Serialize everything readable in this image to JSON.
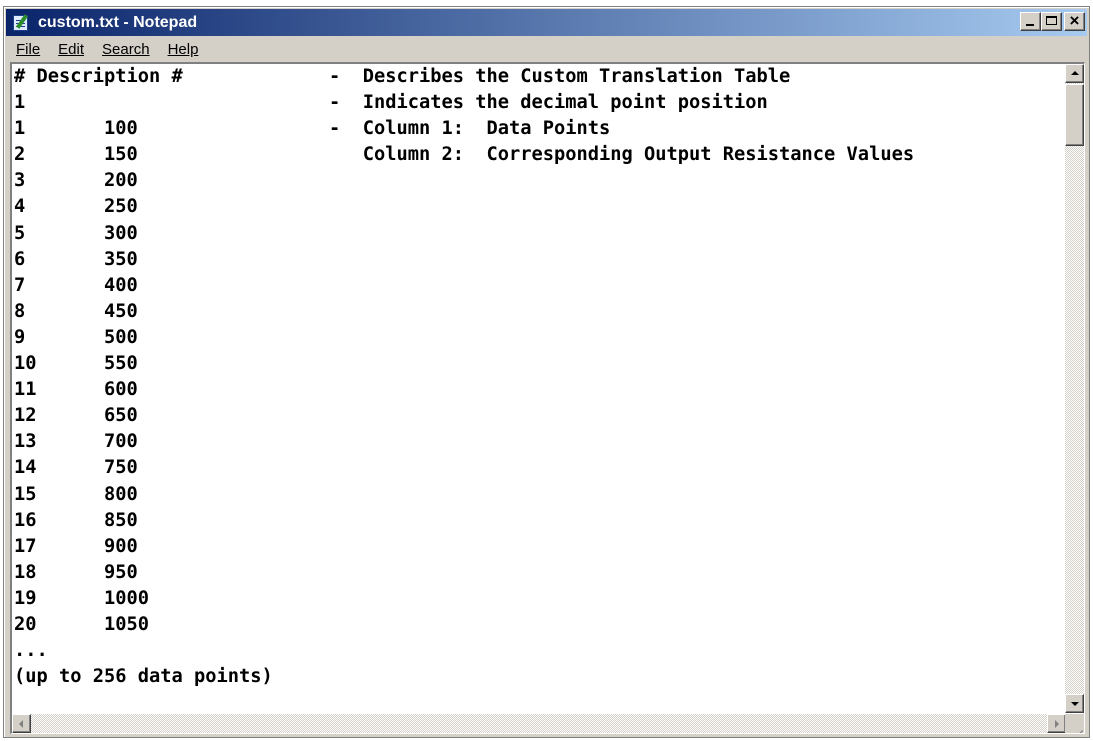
{
  "window": {
    "title": "custom.txt - Notepad",
    "controls": {
      "minimize": "minimize-icon",
      "maximize": "maximize-icon",
      "close": "close-icon"
    }
  },
  "menu": [
    "File",
    "Edit",
    "Search",
    "Help"
  ],
  "document": {
    "lines": [
      "# Description #             -  Describes the Custom Translation Table",
      "1                           -  Indicates the decimal point position",
      "1       100                 -  Column 1:  Data Points",
      "2       150                    Column 2:  Corresponding Output Resistance Values",
      "3       200",
      "4       250",
      "5       300",
      "6       350",
      "7       400",
      "8       450",
      "9       500",
      "10      550",
      "11      600",
      "12      650",
      "13      700",
      "14      750",
      "15      800",
      "16      850",
      "17      900",
      "18      950",
      "19      1000",
      "20      1050",
      "...",
      "(up to 256 data points)"
    ]
  },
  "colors": {
    "titlebar_start": "#0a246a",
    "titlebar_end": "#a6caf0",
    "face": "#d4d0c8"
  }
}
